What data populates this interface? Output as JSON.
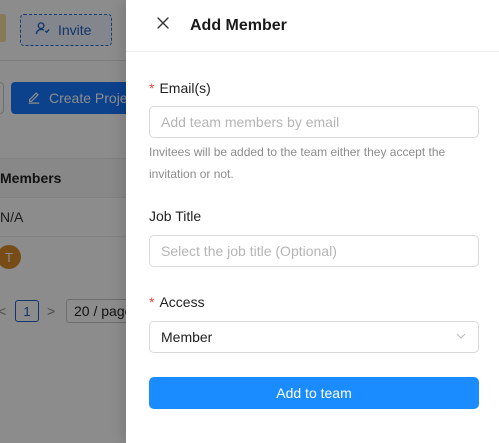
{
  "background": {
    "invite_label": "Invite",
    "create_label": "Create Project",
    "table_header": "Members",
    "row1_value": "N/A",
    "avatar_letter": "T",
    "pager": {
      "prev": "<",
      "current_page": "1",
      "next": ">",
      "page_size": "20 / page"
    },
    "colors": {
      "primary": "#1677ff",
      "avatar": "#d98b2b"
    }
  },
  "drawer": {
    "title": "Add Member",
    "close_icon": "close-icon",
    "fields": {
      "email": {
        "label": "Email(s)",
        "required": "*",
        "placeholder": "Add team members by email",
        "value": "",
        "help": "Invitees will be added to the team either they accept the invitation or not."
      },
      "job_title": {
        "label": "Job Title",
        "placeholder": "Select the job title (Optional)",
        "value": ""
      },
      "access": {
        "label": "Access",
        "required": "*",
        "selected": "Member"
      }
    },
    "submit_label": "Add to team",
    "colors": {
      "primary_button": "#1a8cff",
      "required_mark": "#e0483c"
    }
  }
}
